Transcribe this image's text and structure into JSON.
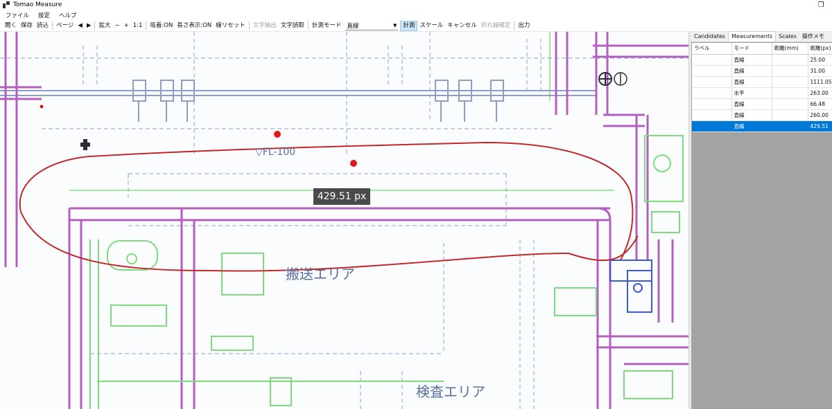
{
  "window": {
    "title": "Tomao Measure",
    "restore_glyph": "❐"
  },
  "menu": [
    "ファイル",
    "設定",
    "ヘルプ"
  ],
  "toolbar": {
    "open": "開く",
    "save": "保存",
    "read": "読込",
    "page": "ページ",
    "prev": "◀",
    "next": "▶",
    "zoom": "拡大",
    "zoom_out": "−",
    "zoom_in": "+",
    "one_to_one": "1:1",
    "snap": "吸着:ON",
    "length_display": "長さ表示:ON",
    "line_reset": "線リセット",
    "text_extract": "文字抽出",
    "text_read": "文字読取",
    "measure_mode_label": "計測モード",
    "measure_mode_value": "直線",
    "measure": "計測",
    "scale": "スケール",
    "cancel": "キャンセル",
    "polyline_confirm": "折れ線確定",
    "output": "出力"
  },
  "canvas": {
    "measurement_label": "429.51 px",
    "area_label_1": "搬送エリア",
    "area_label_2": "検査エリア",
    "fl_label": "▽FL-100",
    "colors": {
      "wall": "#b25fbf",
      "equipment": "#7cdc7c",
      "dimension": "#8fa3c8",
      "annotation": "#c0282a",
      "measure_line": "#4ccb4c"
    }
  },
  "panel": {
    "tabs": [
      "Candidates",
      "Measurements",
      "Scales",
      "操作メモ"
    ],
    "active_tab": "Measurements",
    "columns": [
      "ラベル",
      "モード",
      "距離(mm)",
      "距離(px)"
    ],
    "rows": [
      {
        "label": "",
        "mode": "直線",
        "mm": "",
        "px": "25.00"
      },
      {
        "label": "",
        "mode": "直線",
        "mm": "",
        "px": "31.00"
      },
      {
        "label": "",
        "mode": "直線",
        "mm": "",
        "px": "1111.05"
      },
      {
        "label": "",
        "mode": "水平",
        "mm": "",
        "px": "263.00"
      },
      {
        "label": "",
        "mode": "直線",
        "mm": "",
        "px": "66.48"
      },
      {
        "label": "",
        "mode": "直線",
        "mm": "",
        "px": "260.00"
      },
      {
        "label": "",
        "mode": "直線",
        "mm": "",
        "px": "429.51"
      }
    ],
    "selected_row": 6
  }
}
